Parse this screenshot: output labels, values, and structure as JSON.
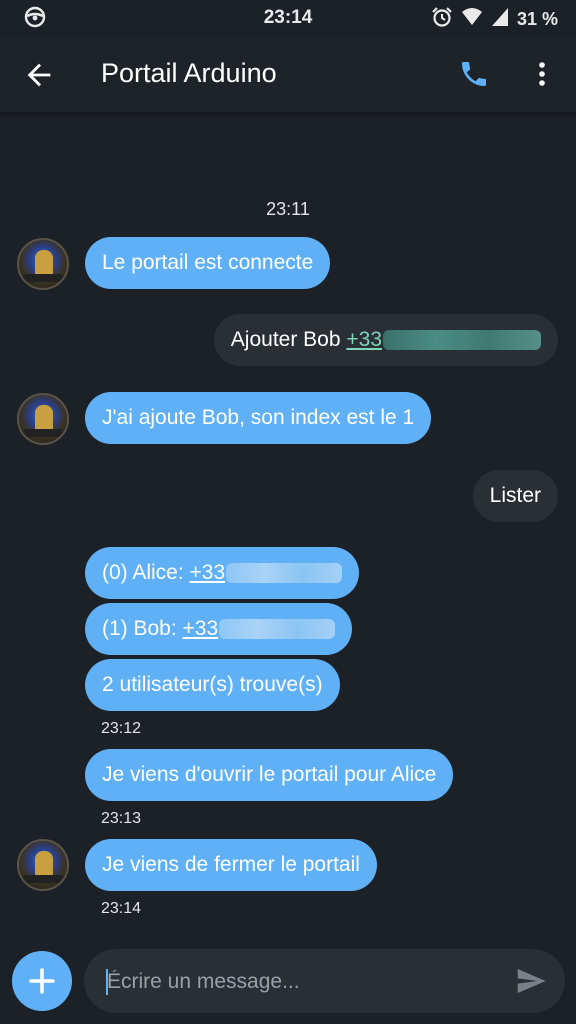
{
  "status_bar": {
    "time": "23:14",
    "battery": "31 %"
  },
  "header": {
    "title": "Portail Arduino"
  },
  "conversation": {
    "first_timestamp": "23:11",
    "messages": [
      {
        "direction": "incoming",
        "text": "Le portail est connecte"
      },
      {
        "direction": "outgoing",
        "prefix": "Ajouter Bob ",
        "link": "+33"
      },
      {
        "direction": "incoming",
        "text": "J'ai ajoute Bob, son index est le 1"
      },
      {
        "direction": "outgoing",
        "text": "Lister"
      },
      {
        "direction": "incoming",
        "prefix": "(0) Alice: ",
        "link": "+33"
      },
      {
        "direction": "incoming",
        "prefix": "(1) Bob: ",
        "link": "+33"
      },
      {
        "direction": "incoming",
        "text": "2 utilisateur(s) trouve(s)",
        "timestamp": "23:12"
      },
      {
        "direction": "incoming",
        "text": "Je viens d'ouvrir le portail pour Alice",
        "timestamp": "23:13"
      },
      {
        "direction": "incoming",
        "text": "Je viens de fermer le portail",
        "timestamp": "23:14"
      }
    ]
  },
  "composer": {
    "placeholder": "Écrire un message..."
  },
  "colors": {
    "background": "#1c2128",
    "incoming_bubble": "#5fb0f4",
    "outgoing_bubble": "#2a2f36",
    "accent": "#5fb0f4"
  },
  "icons": [
    "steering-wheel-icon",
    "alarm-icon",
    "wifi-icon",
    "signal-icon",
    "battery-icon",
    "back-arrow-icon",
    "phone-icon",
    "more-vert-icon",
    "plus-icon",
    "send-icon"
  ]
}
